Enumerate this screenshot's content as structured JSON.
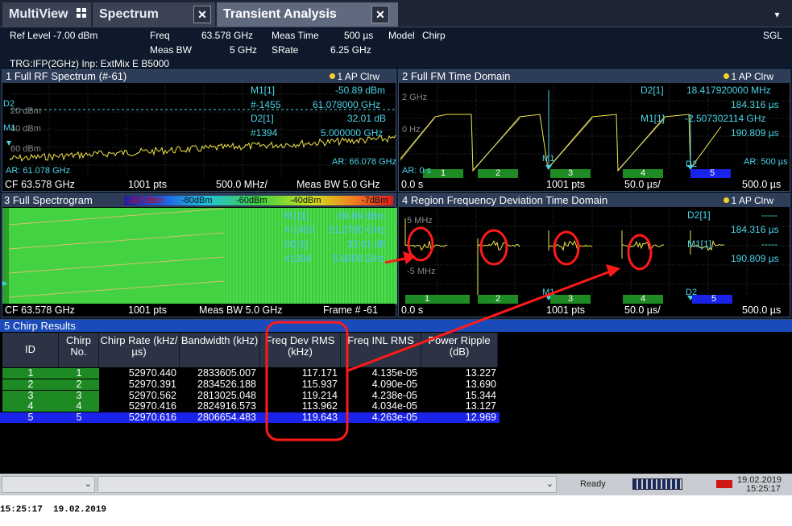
{
  "tabs": [
    {
      "label": "MultiView",
      "icon": "multiview-grid-icon"
    },
    {
      "label": "Spectrum",
      "close": "✕"
    },
    {
      "label": "Transient Analysis",
      "close": "✕"
    }
  ],
  "tab_dropdown": "▾",
  "info": {
    "ref_level": "Ref Level -7.00 dBm",
    "freq_label": "Freq",
    "freq_value": "63.578 GHz",
    "meas_time_label": "Meas Time",
    "meas_time_value": "500 µs",
    "model_label": "Model",
    "model_value": "Chirp",
    "sgl": "SGL",
    "meas_bw_label": "Meas BW",
    "meas_bw_value": "5 GHz",
    "srate_label": "SRate",
    "srate_value": "6.25 GHz",
    "trigger": "TRG:IFP(2GHz) Inp: ExtMix E B5000"
  },
  "pane1": {
    "title": "1 Full RF Spectrum (#-61)",
    "ap": "1 AP Clrw",
    "y_ticks": [
      "20 dBm",
      "40 dBm",
      "60 dBm"
    ],
    "marker_labels": [
      "D2",
      "M1"
    ],
    "m1_name": "M1[1]",
    "m1_val": "-50.89 dBm",
    "m1_pts": "#-1455",
    "m1_freq": "61.078000 GHz",
    "d2_name": "D2[1]",
    "d2_val": "32.01 dB",
    "d2_pts": "#1394",
    "d2_freq": "5.000000 GHz",
    "ar_left": "AR: 61.078 GHz",
    "ar_right": "AR: 66.078 GHz",
    "cf": "CF 63.578 GHz",
    "pts": "1001 pts",
    "span": "500.0 MHz/",
    "meas_bw": "Meas BW 5.0 GHz"
  },
  "pane2": {
    "title": "2 Full FM Time Domain",
    "ap": "1 AP Clrw",
    "y_ticks": [
      "2 GHz",
      "0 Hz"
    ],
    "d2_name": "D2[1]",
    "d2_freq": "18.417920000 MHz",
    "d2_time": "184.316 µs",
    "m1_name": "M1[1]",
    "m1_freq": "-2.507302114 GHz",
    "m1_time": "190.809 µs",
    "ar_left": "AR: 0 s",
    "ar_right": "AR: 500 µs",
    "m1_label": "M1",
    "d2_label": "D2",
    "chirps": [
      "1",
      "2",
      "3",
      "4",
      "5"
    ],
    "x_start": "0.0 s",
    "pts": "1001 pts",
    "div": "50.0 µs/",
    "x_end": "500.0 µs"
  },
  "pane3": {
    "title": "3 Full Spectrogram",
    "scale": [
      "-107dBm",
      "-80dBm",
      "-60dBm",
      "-40dBm",
      "-7dBm"
    ],
    "m1_name": "M1[1]",
    "m1_val": "-50.89 dBm",
    "m1_pts": "#-1455",
    "m1_freq": "61.0780 GHz",
    "d2_name": "D2[1]",
    "d2_val": "32.01 dB",
    "d2_pts": "#1394",
    "d2_freq": "5.0000 GHz",
    "cf": "CF 63.578 GHz",
    "pts": "1001 pts",
    "meas_bw": "Meas BW 5.0 GHz",
    "frame": "Frame # -61"
  },
  "pane4": {
    "title": "4 Region Frequency Deviation Time Domain",
    "ap": "1 AP Clrw",
    "y_ticks": [
      "5 MHz",
      "-5 MHz"
    ],
    "d2_name": "D2[1]",
    "d2_val": "-----",
    "d2_time": "184.316 µs",
    "m1_name": "M1[1]",
    "m1_val": "-----",
    "m1_time": "190.809 µs",
    "m1_label": "M1",
    "d2_label": "D2",
    "chirps": [
      "1",
      "2",
      "3",
      "4",
      "5"
    ],
    "x_start": "0.0 s",
    "pts": "1001 pts",
    "div": "50.0 µs/",
    "x_end": "500.0 µs"
  },
  "results": {
    "title": "5 Chirp Results",
    "headers": [
      "ID",
      "Chirp No.",
      "Chirp Rate (kHz/µs)",
      "Bandwidth (kHz)",
      "Freq Dev RMS (kHz)",
      "Freq INL RMS",
      "Power Ripple (dB)"
    ],
    "rows": [
      [
        "1",
        "1",
        "52970.440",
        "2833605.007",
        "117.171",
        "4.135e-05",
        "13.227"
      ],
      [
        "2",
        "2",
        "52970.391",
        "2834526.188",
        "115.937",
        "4.090e-05",
        "13.690"
      ],
      [
        "3",
        "3",
        "52970.562",
        "2813025.048",
        "119.214",
        "4.238e-05",
        "15.344"
      ],
      [
        "4",
        "4",
        "52970.416",
        "2824916.573",
        "113.962",
        "4.034e-05",
        "13.127"
      ],
      [
        "5",
        "5",
        "52970.616",
        "2806654.483",
        "119.643",
        "4.263e-05",
        "12.969"
      ]
    ],
    "selected_row": 5
  },
  "status": {
    "ready": "Ready",
    "date": "19.02.2019",
    "time": "15:25:17",
    "dropdown": "⌄"
  },
  "footer": "15:25:17  19.02.2019",
  "colors": {
    "trace": "#f2e64a",
    "marker": "#4ad4e8",
    "annotation": "#ff1a1a",
    "chirp_bar": "#1d8a23",
    "selection": "#1a23e8"
  }
}
